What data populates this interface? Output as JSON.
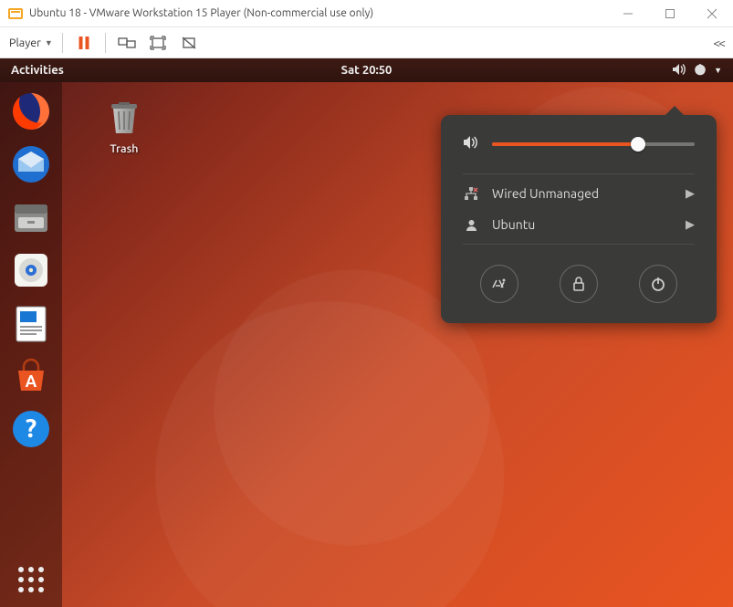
{
  "window": {
    "title": "Ubuntu 18 - VMware Workstation 15 Player (Non-commercial use only)"
  },
  "vm_toolbar": {
    "player_label": "Player",
    "icons": {
      "pause": "pause-icon",
      "devices": "devices-icon",
      "fullscreen": "fullscreen-enter-icon",
      "unity": "unity-icon"
    },
    "collapse_glyph": "<<"
  },
  "topbar": {
    "activities": "Activities",
    "clock": "Sat 20:50",
    "tray_icons": [
      "volume-icon",
      "power-icon",
      "chevron-down-icon"
    ]
  },
  "desktop": {
    "icons": [
      {
        "name": "trash",
        "label": "Trash"
      }
    ]
  },
  "dock": {
    "launchers": [
      {
        "name": "firefox",
        "color_a": "#ff7139",
        "color_b": "#9059ff"
      },
      {
        "name": "thunderbird",
        "color_a": "#1f6fd0",
        "color_b": "#9ac7f0"
      },
      {
        "name": "files",
        "color_a": "#8a5a3b",
        "color_b": "#d9c5a0"
      },
      {
        "name": "rhythmbox",
        "color_a": "#f5f5f2",
        "color_b": "#9bbf3b"
      },
      {
        "name": "libreoffice-writer",
        "color_a": "#1976d2",
        "color_b": "#ffffff"
      },
      {
        "name": "ubuntu-software",
        "color_a": "#e95420",
        "color_b": "#ffffff"
      },
      {
        "name": "help",
        "color_a": "#1e88e5",
        "color_b": "#ffffff"
      }
    ]
  },
  "system_menu": {
    "volume": {
      "percent": 72
    },
    "items": [
      {
        "icon": "ethernet-disconnected-icon",
        "label": "Wired Unmanaged"
      },
      {
        "icon": "user-icon",
        "label": "Ubuntu"
      }
    ],
    "actions": [
      {
        "name": "settings",
        "icon": "settings-icon"
      },
      {
        "name": "lock",
        "icon": "lock-icon"
      },
      {
        "name": "power",
        "icon": "power-icon"
      }
    ]
  }
}
